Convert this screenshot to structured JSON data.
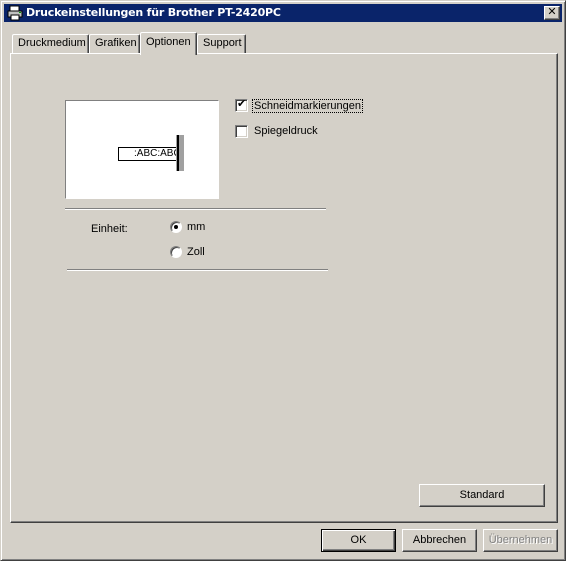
{
  "window": {
    "title": "Druckeinstellungen für Brother PT-2420PC",
    "close_label": "✕",
    "title_icon": "printer-icon"
  },
  "tabs": [
    {
      "label": "Druckmedium"
    },
    {
      "label": "Grafiken"
    },
    {
      "label": "Optionen",
      "active": true
    },
    {
      "label": "Support"
    }
  ],
  "preview": {
    "label_text": ":ABC:ABC"
  },
  "options": {
    "cut_marks": {
      "label": "Schneidmarkierungen",
      "checked": true
    },
    "mirror_print": {
      "label": "Spiegeldruck",
      "checked": false
    }
  },
  "unit": {
    "label": "Einheit:",
    "options": [
      {
        "label": "mm",
        "selected": true
      },
      {
        "label": "Zoll",
        "selected": false
      }
    ]
  },
  "buttons": {
    "default": "Standard",
    "ok": "OK",
    "cancel": "Abbrechen",
    "apply": "Übernehmen"
  }
}
